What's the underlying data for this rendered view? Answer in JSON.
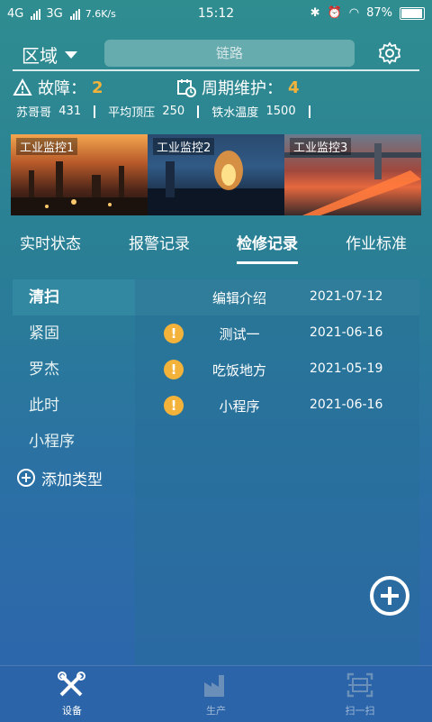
{
  "status": {
    "net1": "4G",
    "net2": "3G",
    "speed": "7.6K/s",
    "time": "15:12",
    "battery": "87%"
  },
  "header": {
    "region_label": "区域",
    "search_placeholder": "链路"
  },
  "summary": {
    "fault_label": "故障：",
    "fault_count": "2",
    "maint_label": "周期维护：",
    "maint_count": "4"
  },
  "stats": [
    {
      "label": "苏哥哥",
      "value": "431"
    },
    {
      "label": "平均顶压",
      "value": "250"
    },
    {
      "label": "铁水温度",
      "value": "1500"
    }
  ],
  "cameras": [
    "工业监控1",
    "工业监控2",
    "工业监控3"
  ],
  "tabs": [
    "实时状态",
    "报警记录",
    "检修记录",
    "作业标准"
  ],
  "active_tab": "检修记录",
  "categories": [
    "清扫",
    "紧固",
    "罗杰",
    "此时",
    "小程序"
  ],
  "add_type_label": "添加类型",
  "records": [
    {
      "name": "编辑介绍",
      "date": "2021-07-12",
      "warn": false
    },
    {
      "name": "测试一",
      "date": "2021-06-16",
      "warn": true
    },
    {
      "name": "吃饭地方",
      "date": "2021-05-19",
      "warn": true
    },
    {
      "name": "小程序",
      "date": "2021-06-16",
      "warn": true
    }
  ],
  "bottom_nav": [
    {
      "label": "设备",
      "icon": "tools-icon",
      "active": true
    },
    {
      "label": "生产",
      "icon": "factory-icon",
      "active": false
    },
    {
      "label": "扫一扫",
      "icon": "scan-icon",
      "active": false
    }
  ],
  "colors": {
    "accent": "#f3b33a",
    "bg_top": "#2f8d90",
    "bg_bottom": "#2d63ad"
  }
}
